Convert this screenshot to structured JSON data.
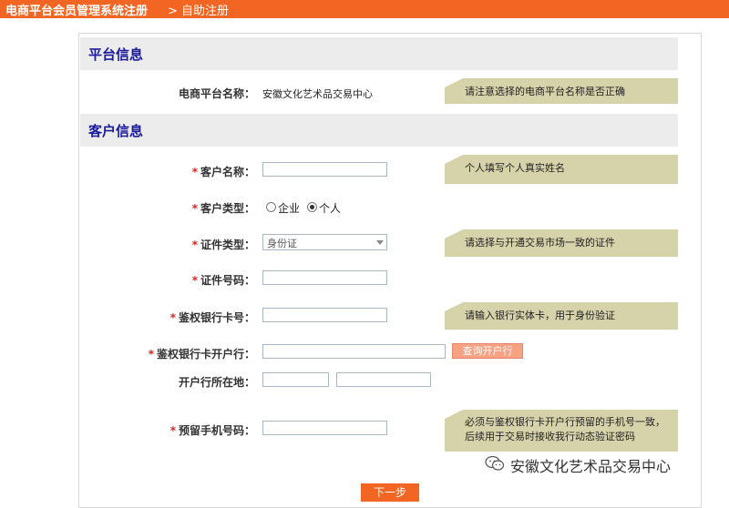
{
  "header": {
    "title": "电商平台会员管理系统注册",
    "crumb": "> 自助注册"
  },
  "sections": {
    "platform": "平台信息",
    "customer": "客户信息"
  },
  "platform": {
    "label": "电商平台名称：",
    "value": "安徽文化艺术品交易中心",
    "tip": "请注意选择的电商平台名称是否正确"
  },
  "customer": {
    "name": {
      "required": "*",
      "label": "客户名称：",
      "value": "",
      "tip": "个人填写个人真实姓名"
    },
    "type": {
      "required": "*",
      "label": "客户类型：",
      "options": [
        "企业",
        "个人"
      ],
      "selected": "个人"
    },
    "id_type": {
      "required": "*",
      "label": "证件类型：",
      "value": "身份证",
      "tip": "请选择与开通交易市场一致的证件"
    },
    "id_number": {
      "required": "*",
      "label": "证件号码：",
      "value": ""
    },
    "bank_card": {
      "required": "*",
      "label": "鉴权银行卡号：",
      "value": "",
      "tip": "请输入银行实体卡，用于身份验证"
    },
    "bank_branch": {
      "required": "*",
      "label": "鉴权银行卡开户行：",
      "value": "",
      "query_button": "查询开户行"
    },
    "bank_location": {
      "label": "开户行所在地：",
      "province": "",
      "city": ""
    },
    "phone": {
      "required": "*",
      "label": "预留手机号码：",
      "value": "",
      "tip": "必须与鉴权银行卡开户行预留的手机号一致，后续用于交易时接收我行动态验证密码"
    }
  },
  "actions": {
    "next": "下一步"
  },
  "watermark": {
    "text": "安徽文化艺术品交易中心",
    "icon": "wechat-logo-icon"
  },
  "colors": {
    "brand": "#f26522",
    "section_title": "#1a1a9c",
    "tip_bg": "#d6d3ab",
    "required": "#e02020"
  }
}
